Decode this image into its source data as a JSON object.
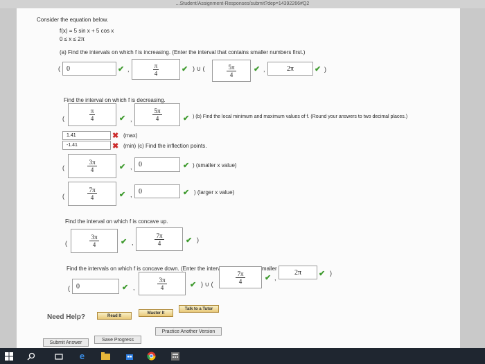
{
  "browser": {
    "url": "...Student/Assignment-Responses/submit?dep=14392266#Q2"
  },
  "question": {
    "prompt": "Consider the equation below.",
    "f_def": "f(x) = 5 sin x + 5 cos x",
    "domain": "0 ≤ x ≤ 2π",
    "a_text": "(a) Find the intervals on which f is increasing. (Enter the interval that contains smaller numbers first.)",
    "decreasing_text": "Find the interval on which f is decreasing.",
    "b_text": ") (b) Find the local minimum and maximum values of f. (Round your answers to two decimal places.)",
    "max_label": "(max)",
    "min_label": "(min) (c) Find the inflection points.",
    "smaller_x": ") (smaller x value)",
    "larger_x": ") (larger x value)",
    "concave_up_text": "Find the interval on which f is concave up.",
    "concave_down_text": "Find the intervals on which f is concave down. (Enter the interval that contains smaller numbers first.)"
  },
  "answers": {
    "inc_1_left": "0",
    "inc_1_right": {
      "num": "π",
      "den": "4"
    },
    "inc_2_left": {
      "num": "5π",
      "den": "4"
    },
    "inc_2_right": "2π",
    "dec_left": {
      "num": "π",
      "den": "4"
    },
    "dec_right": {
      "num": "5π",
      "den": "4"
    },
    "max_value": "1.41",
    "min_value": "-1.41",
    "infl_1_x": {
      "num": "3π",
      "den": "4"
    },
    "infl_1_y": "0",
    "infl_2_x": {
      "num": "7π",
      "den": "4"
    },
    "infl_2_y": "0",
    "cu_left": {
      "num": "3π",
      "den": "4"
    },
    "cu_right": {
      "num": "7π",
      "den": "4"
    },
    "cd_1_left": "0",
    "cd_1_right": {
      "num": "3π",
      "den": "4"
    },
    "cd_2_left": {
      "num": "7π",
      "den": "4"
    },
    "cd_2_right": "2π"
  },
  "symbols": {
    "open_paren": "(",
    "close_paren": ")",
    "comma": ",",
    "union": ") ∪ (",
    "check": "✔",
    "cross": "✖"
  },
  "footer": {
    "need_help": "Need Help?",
    "read_it": "Read It",
    "master_it": "Master It",
    "talk_tutor": "Talk to a Tutor",
    "submit_answer": "Submit Answer",
    "save_progress": "Save Progress",
    "practice_another": "Practice Another Version"
  },
  "colors": {
    "check": "#3e9a2e",
    "cross": "#cc2b2b",
    "taskbar": "#1f2630"
  }
}
